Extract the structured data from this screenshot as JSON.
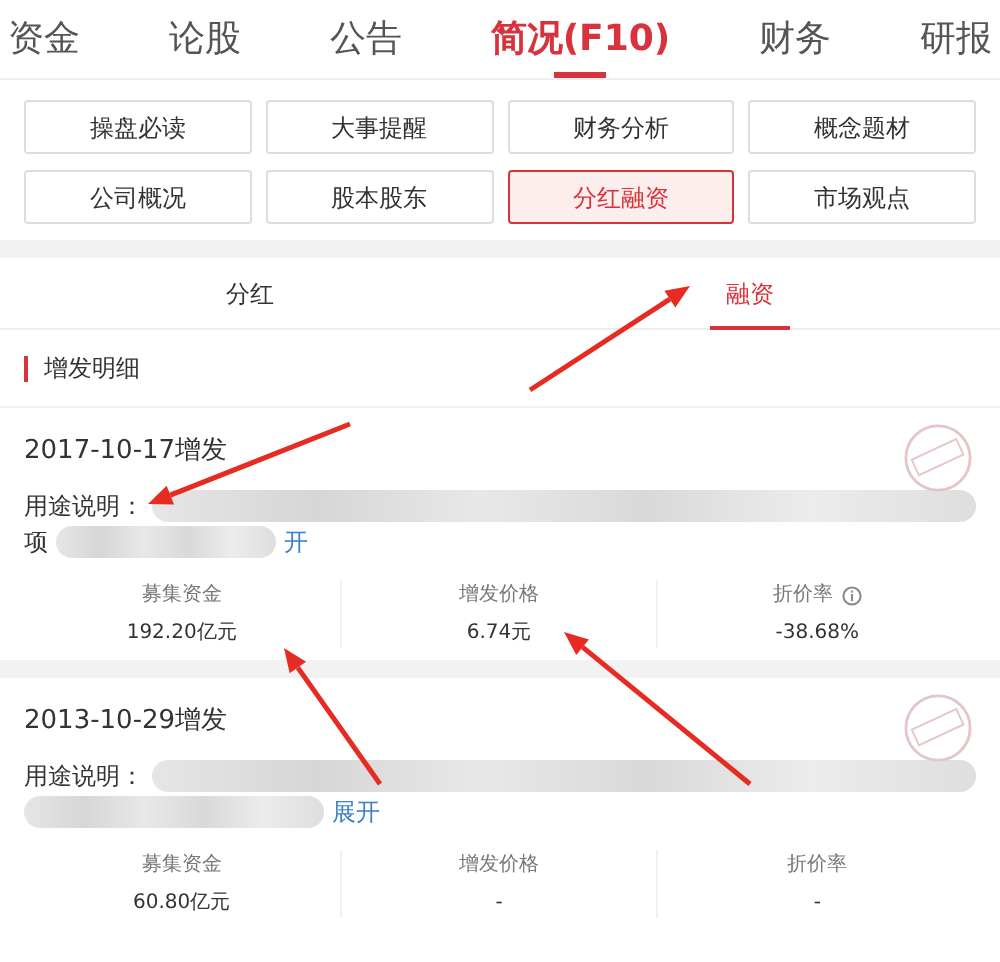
{
  "top_tabs": [
    {
      "label": "资金",
      "selected": false
    },
    {
      "label": "论股",
      "selected": false
    },
    {
      "label": "公告",
      "selected": false
    },
    {
      "label": "简况(F10)",
      "selected": true
    },
    {
      "label": "财务",
      "selected": false
    },
    {
      "label": "研报",
      "selected": false
    }
  ],
  "sections": [
    {
      "label": "操盘必读",
      "selected": false
    },
    {
      "label": "大事提醒",
      "selected": false
    },
    {
      "label": "财务分析",
      "selected": false
    },
    {
      "label": "概念题材",
      "selected": false
    },
    {
      "label": "公司概况",
      "selected": false
    },
    {
      "label": "股本股东",
      "selected": false
    },
    {
      "label": "分红融资",
      "selected": true
    },
    {
      "label": "市场观点",
      "selected": false
    }
  ],
  "sub_tabs": [
    {
      "label": "分红",
      "selected": false
    },
    {
      "label": "融资",
      "selected": true
    }
  ],
  "section_title": "增发明细",
  "issues": [
    {
      "title": "2017-10-17增发",
      "purpose_label": "用途说明：",
      "second_line": "项",
      "expand_link": "开",
      "stats": [
        {
          "label": "募集资金",
          "value": "192.20亿元",
          "info": false
        },
        {
          "label": "增发价格",
          "value": "6.74元",
          "info": false
        },
        {
          "label": "折价率",
          "value": "-38.68%",
          "info": true
        }
      ]
    },
    {
      "title": "2013-10-29增发",
      "purpose_label": "用途说明：",
      "expand_link": "展开",
      "stats": [
        {
          "label": "募集资金",
          "value": "60.80亿元",
          "info": false
        },
        {
          "label": "增发价格",
          "value": "-",
          "info": false
        },
        {
          "label": "折价率",
          "value": "-",
          "info": false
        }
      ]
    }
  ]
}
